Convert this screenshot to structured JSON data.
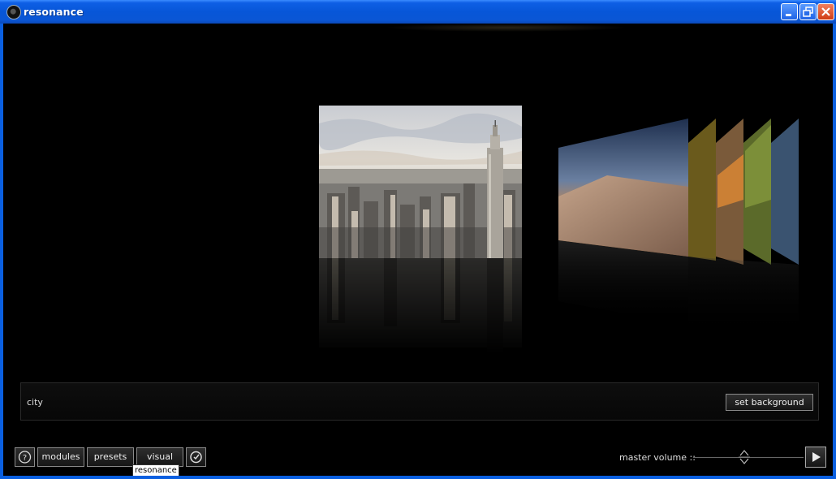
{
  "window": {
    "title": "resonance"
  },
  "titlebar_buttons": {
    "minimize": "minimize-icon",
    "restore": "restore-icon",
    "close": "close-icon"
  },
  "coverflow": {
    "current_name": "city",
    "set_background_label": "set background"
  },
  "toolbar": {
    "help_icon": "help-icon",
    "modules_label": "modules",
    "presets_label": "presets",
    "visual_label": "visual",
    "power_icon": "power-icon",
    "tooltip": "resonance"
  },
  "volume": {
    "label": "master volume ::",
    "level": 0.46,
    "play_icon": "play-icon"
  },
  "colors": {
    "titlebar": "#0a56d5",
    "background": "#000000",
    "close": "#d03c14"
  }
}
